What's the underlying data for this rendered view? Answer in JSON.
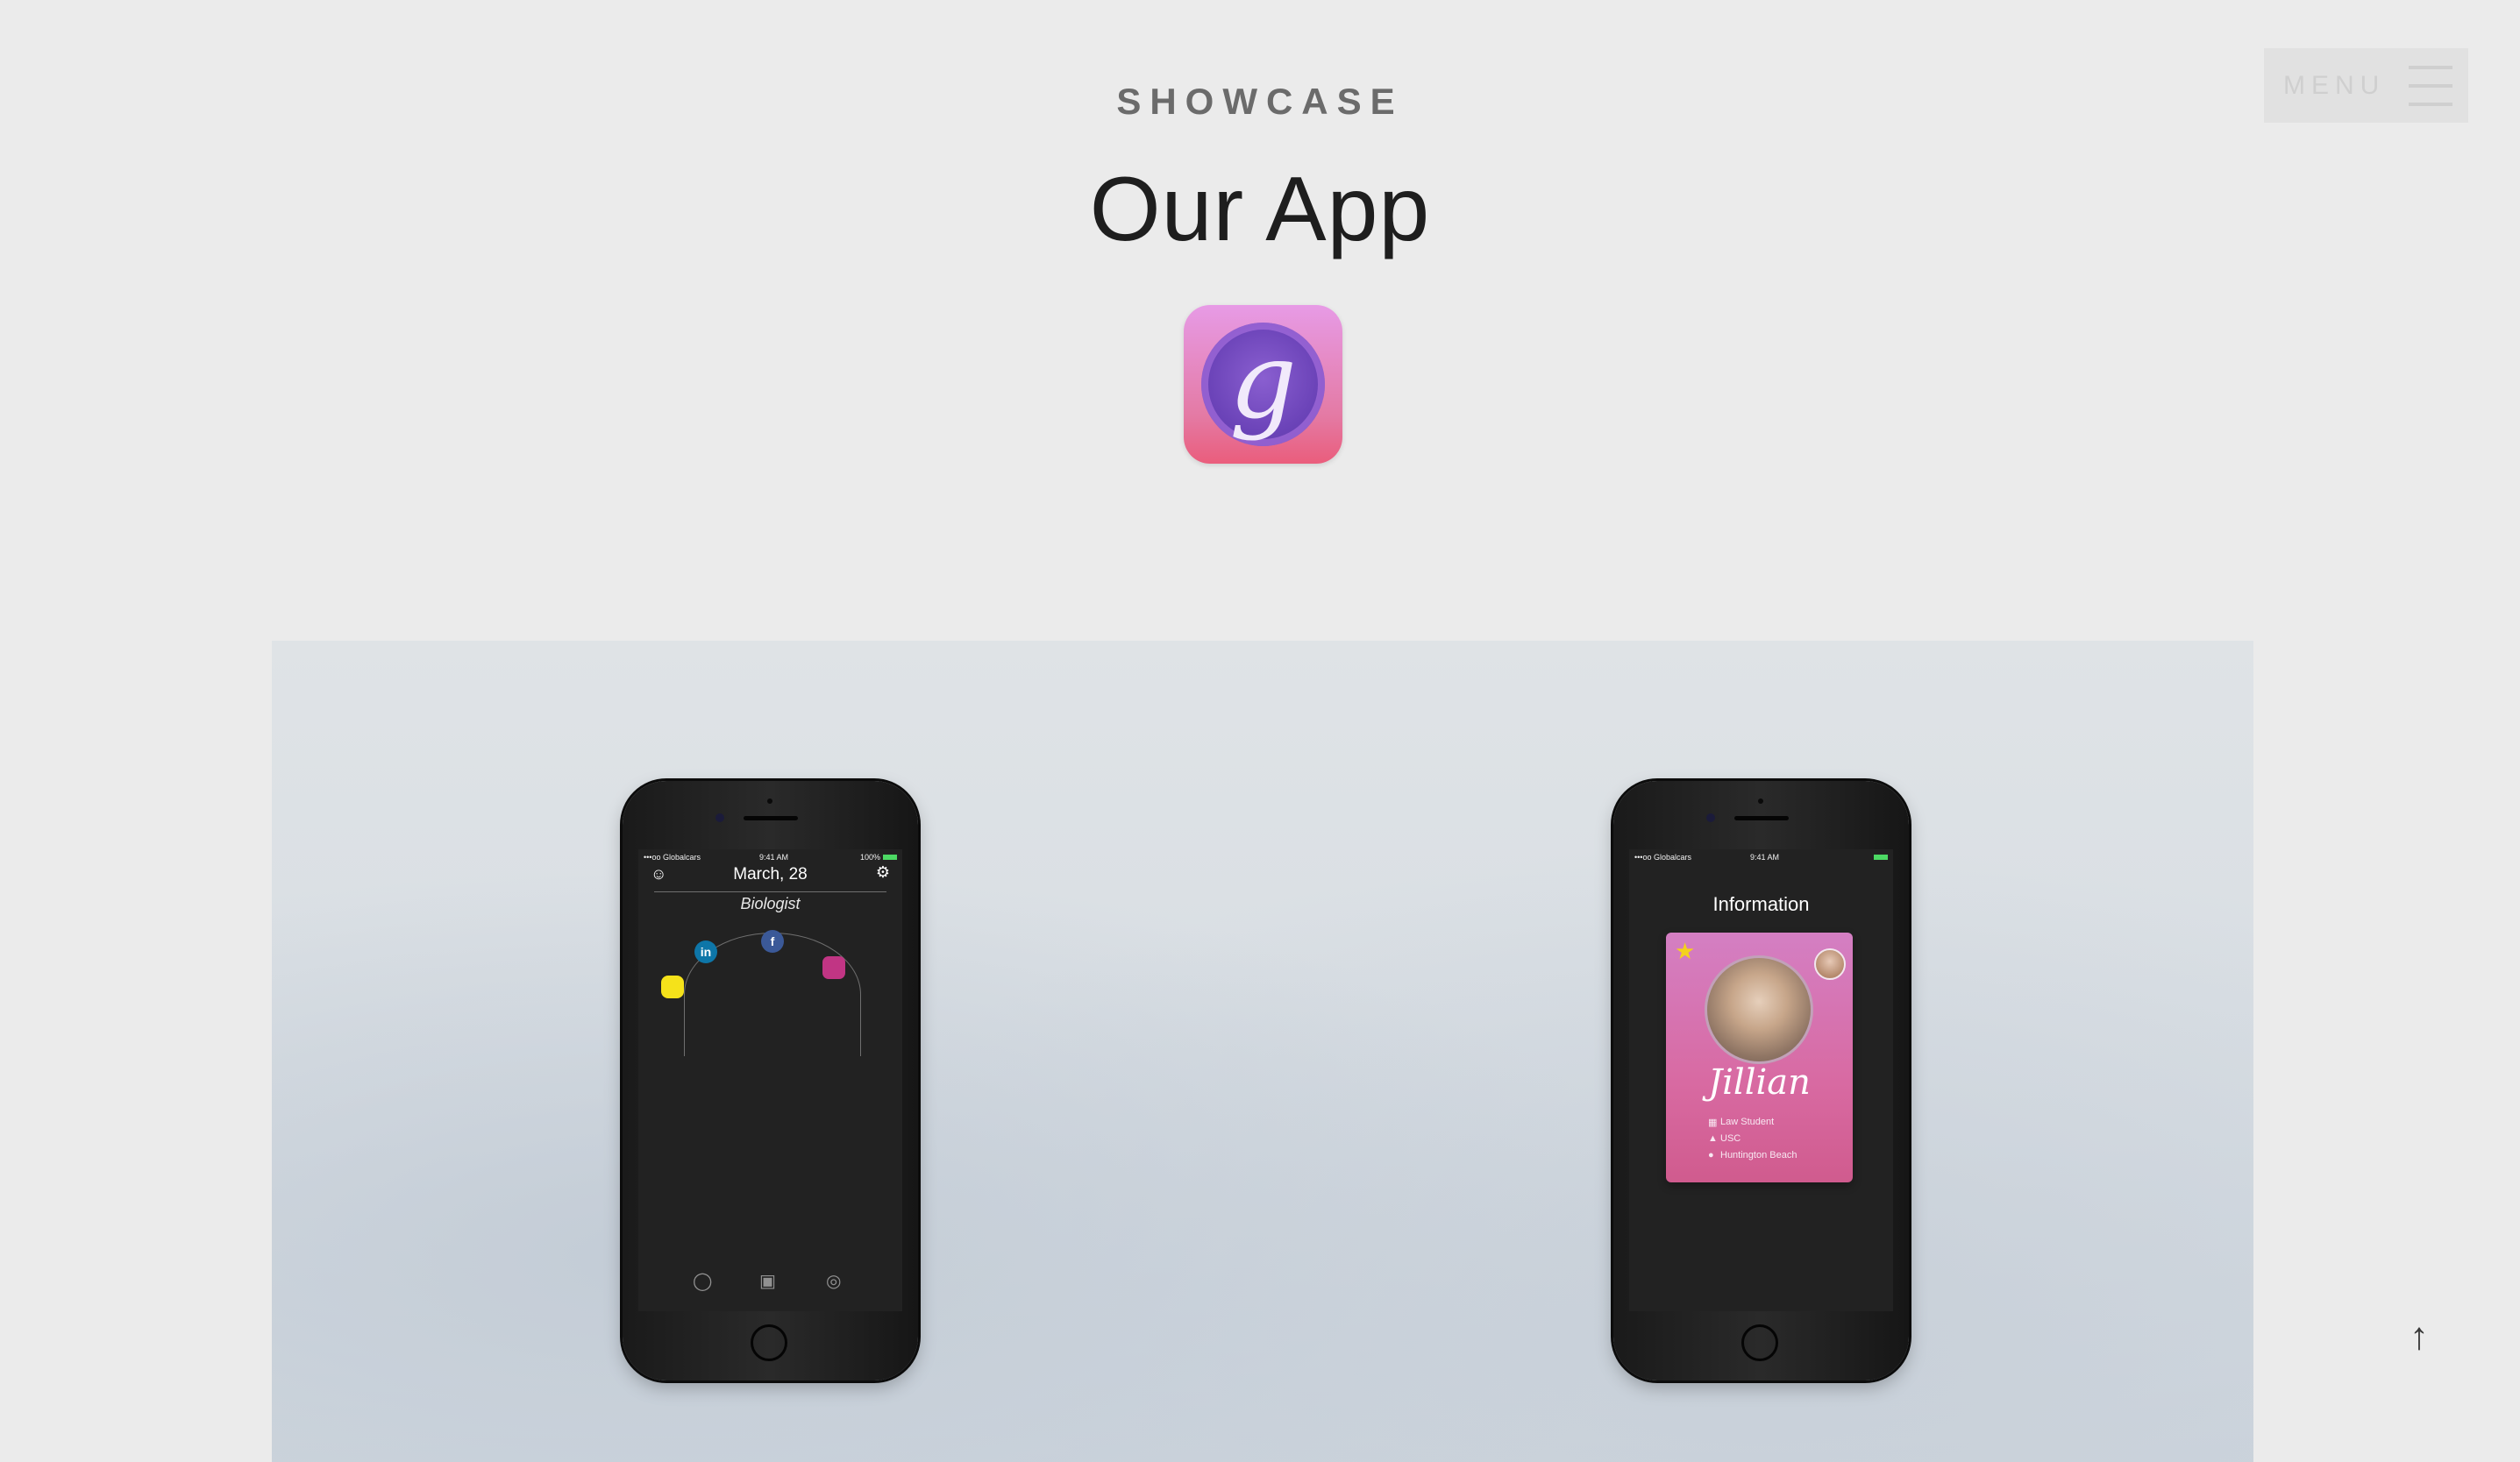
{
  "header": {
    "eyebrow": "SHOWCASE",
    "title": "Our App",
    "app_icon_letter": "g"
  },
  "menu": {
    "label": "MENU",
    "icon": "hamburger-icon"
  },
  "colors": {
    "background": "#ebebeb",
    "heading": "#1e1e1e",
    "eyebrow": "#6b6b6b",
    "app_icon_top": "#e79be6",
    "app_icon_bottom": "#ea5d7c",
    "card_pink": "#d86aa2"
  },
  "phones": [
    {
      "status": {
        "carrier": "•••oo Globalcars",
        "time": "9:41 AM",
        "battery": "100%"
      },
      "date": "March, 28",
      "role": "Biologist",
      "icons": [
        "person-icon",
        "gear-icon",
        "linkedin-icon",
        "facebook-icon",
        "snapchat-icon",
        "instagram-icon",
        "camera-icon"
      ],
      "social": {
        "linkedin": "in",
        "facebook": "f"
      }
    },
    {
      "status": {
        "carrier": "•••oo Globalcars",
        "time": "9:41 AM",
        "battery": ""
      },
      "screen_title": "Information",
      "card": {
        "name": "Jillian",
        "details": [
          "Law Student",
          "USC",
          "Huntington Beach"
        ]
      }
    }
  ],
  "scroll_top": {
    "icon": "arrow-up-icon",
    "glyph": "↑"
  }
}
